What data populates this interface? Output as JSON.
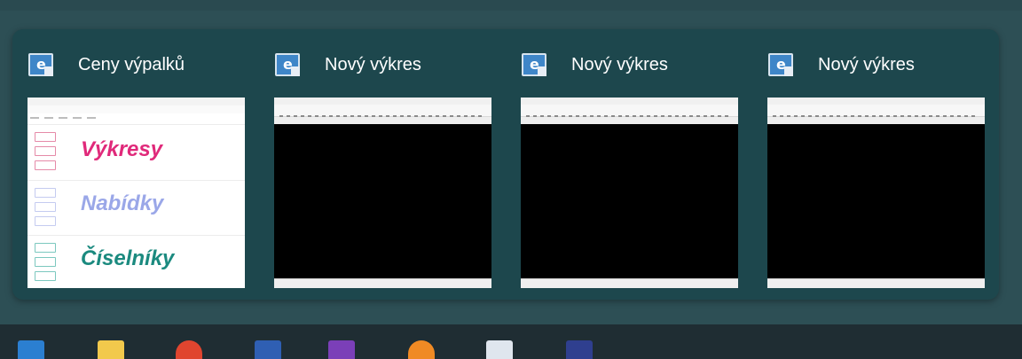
{
  "switcher": {
    "windows": [
      {
        "title": "Ceny výpalků",
        "icon": "app-window-icon",
        "thumbnail": {
          "kind": "menu-app",
          "sections": [
            {
              "label": "Výkresy",
              "color": "#e0297a"
            },
            {
              "label": "Nabídky",
              "color": "#9aa7e8"
            },
            {
              "label": "Číselníky",
              "color": "#1b8a7f"
            }
          ]
        }
      },
      {
        "title": "Nový výkres",
        "icon": "app-window-icon",
        "thumbnail": {
          "kind": "cad"
        }
      },
      {
        "title": "Nový výkres",
        "icon": "app-window-icon",
        "thumbnail": {
          "kind": "cad"
        }
      },
      {
        "title": "Nový výkres",
        "icon": "app-window-icon",
        "thumbnail": {
          "kind": "cad"
        }
      }
    ]
  },
  "taskbar": {
    "icons": [
      {
        "name": "vscode-icon",
        "color": "#2b7fd1"
      },
      {
        "name": "file-explorer-icon",
        "color": "#f2c94c"
      },
      {
        "name": "chrome-icon",
        "color": "#e0452f"
      },
      {
        "name": "save-disk-icon",
        "color": "#2f5fb3"
      },
      {
        "name": "visual-studio-icon",
        "color": "#7b3fb8"
      },
      {
        "name": "firefox-icon",
        "color": "#f08a24"
      },
      {
        "name": "app-window-icon",
        "color": "#dfe6ee"
      },
      {
        "name": "calendar-app-icon",
        "color": "#2f3f8f"
      }
    ]
  }
}
